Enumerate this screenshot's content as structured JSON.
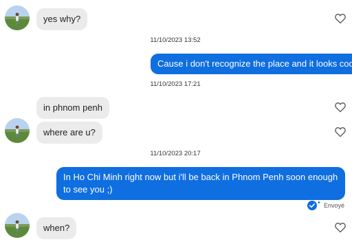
{
  "messages": {
    "m1": "yes why?",
    "ts1": "11/10/2023 13:52",
    "m2": "Cause i don't recognize the place and it looks cool",
    "ts2": "11/10/2023 17:21",
    "m3": "in phnom penh",
    "m4": "where are u?",
    "ts3": "11/10/2023 20:17",
    "m5": "In Ho Chi Minh right now but i'll be back in Phnom Penh soon enough to see you ;)",
    "status": "Envoyé",
    "m6": "when?"
  },
  "colors": {
    "outgoing_bubble": "#0f6ee0",
    "incoming_bubble": "#ebebeb",
    "heart_outline": "#555555"
  },
  "icons": {
    "like": "heart-outline-icon",
    "sent": "check-circle-icon"
  }
}
